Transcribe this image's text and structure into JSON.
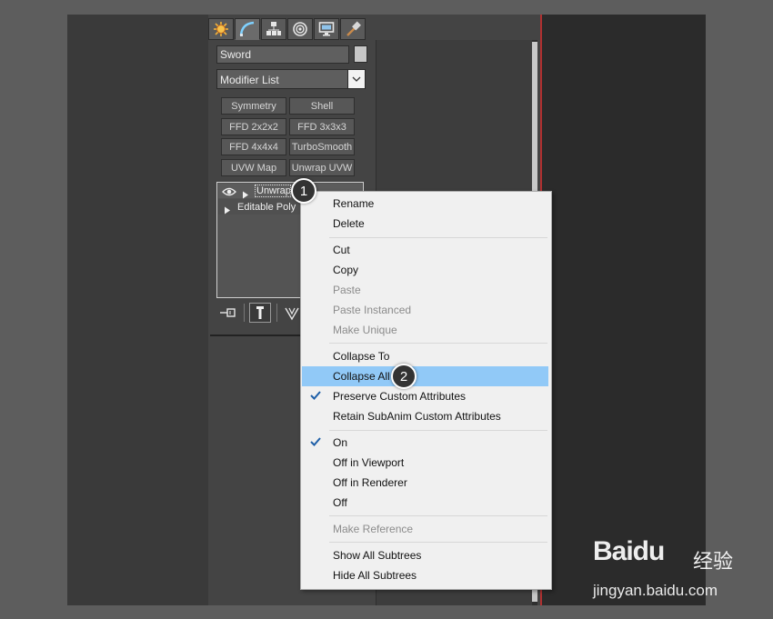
{
  "command_panel": {
    "tabs": [
      {
        "name": "create",
        "icon": "sun-icon"
      },
      {
        "name": "modify",
        "icon": "modify-arc-icon"
      },
      {
        "name": "hierarchy",
        "icon": "hierarchy-icon"
      },
      {
        "name": "motion",
        "icon": "motion-icon"
      },
      {
        "name": "display",
        "icon": "display-monitor-icon"
      },
      {
        "name": "utilities",
        "icon": "hammer-icon"
      }
    ],
    "object_name": "Sword",
    "color_swatch": "#c7c7c7",
    "modifier_list_label": "Modifier List",
    "modifier_buttons": [
      "Symmetry",
      "Shell",
      "FFD 2x2x2",
      "FFD 3x3x3",
      "FFD 4x4x4",
      "TurboSmooth",
      "UVW Map",
      "Unwrap UVW"
    ],
    "stack": {
      "items": [
        {
          "label": "Unwrap UVW"
        },
        {
          "label": "Editable Poly"
        }
      ]
    }
  },
  "context_menu": {
    "highlight_color": "#91c9f7",
    "groups": [
      [
        {
          "label": "Rename",
          "enabled": true
        },
        {
          "label": "Delete",
          "enabled": true
        }
      ],
      [
        {
          "label": "Cut",
          "enabled": true
        },
        {
          "label": "Copy",
          "enabled": true
        },
        {
          "label": "Paste",
          "enabled": false
        },
        {
          "label": "Paste Instanced",
          "enabled": false
        },
        {
          "label": "Make Unique",
          "enabled": false
        }
      ],
      [
        {
          "label": "Collapse To",
          "enabled": true
        },
        {
          "label": "Collapse All",
          "enabled": true,
          "highlighted": true
        },
        {
          "label": "Preserve Custom Attributes",
          "enabled": true,
          "checked": true
        },
        {
          "label": "Retain SubAnim Custom Attributes",
          "enabled": true
        }
      ],
      [
        {
          "label": "On",
          "enabled": true,
          "checked": true
        },
        {
          "label": "Off in Viewport",
          "enabled": true
        },
        {
          "label": "Off in Renderer",
          "enabled": true
        },
        {
          "label": "Off",
          "enabled": true
        }
      ],
      [
        {
          "label": "Make Reference",
          "enabled": false
        }
      ],
      [
        {
          "label": "Show All Subtrees",
          "enabled": true
        },
        {
          "label": "Hide All Subtrees",
          "enabled": true
        }
      ]
    ]
  },
  "annotations": {
    "badge_1": "1",
    "badge_2": "2"
  },
  "watermark": {
    "logo": "Baidu",
    "cn": "经验",
    "url": "jingyan.baidu.com"
  }
}
